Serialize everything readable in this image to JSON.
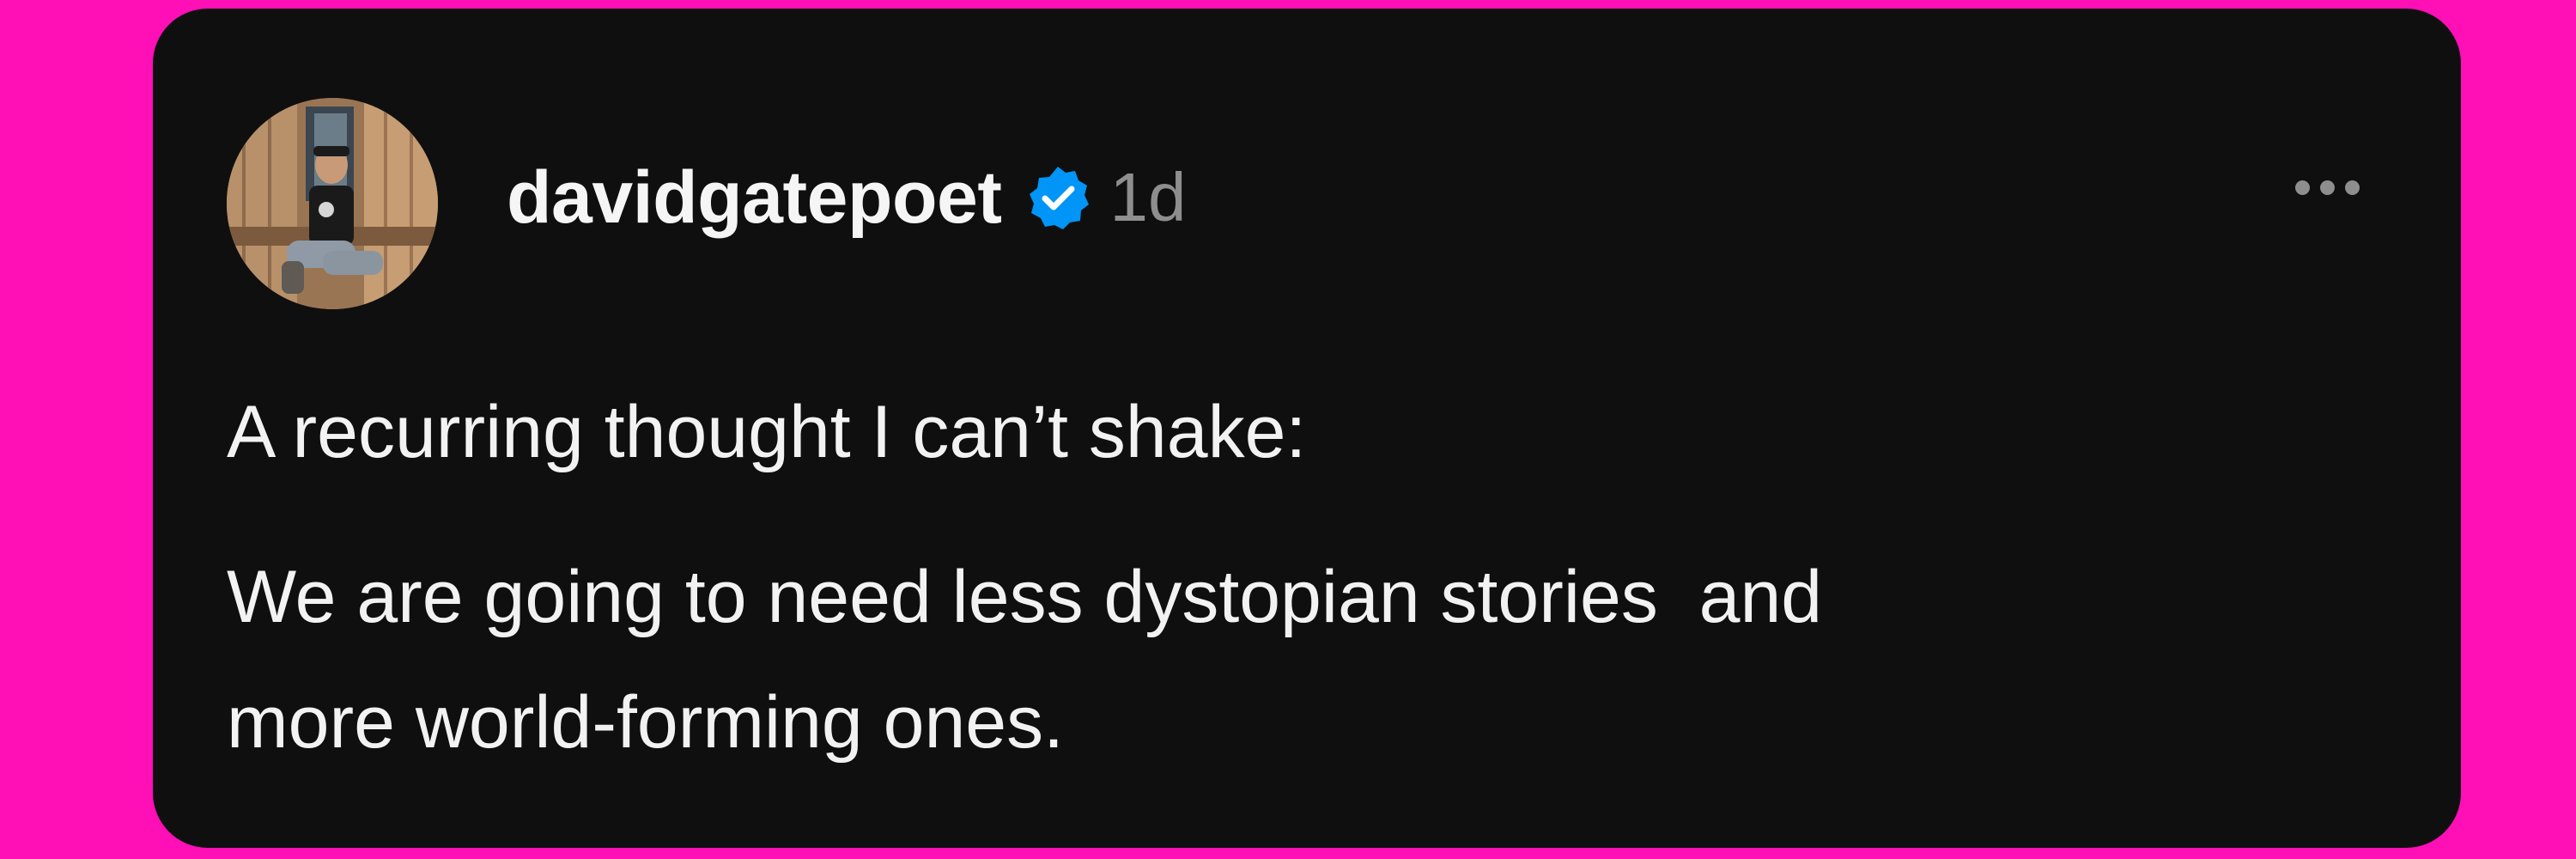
{
  "post": {
    "author": {
      "username": "davidgatepoet",
      "verified": true,
      "avatar": "profile-photo"
    },
    "timestamp": "1d",
    "more_icon": "more-horizontal-icon",
    "verified_icon": "verified-badge-icon",
    "body": {
      "line1": "A recurring thought I can’t shake:",
      "line2": "We are going to need less dystopian stories  and",
      "line3": "more world-forming ones."
    }
  },
  "colors": {
    "background": "#ff0fb6",
    "card": "#0f0f10",
    "text": "#f2f2f2",
    "muted": "#8e8e8e",
    "verified": "#0095f6"
  }
}
